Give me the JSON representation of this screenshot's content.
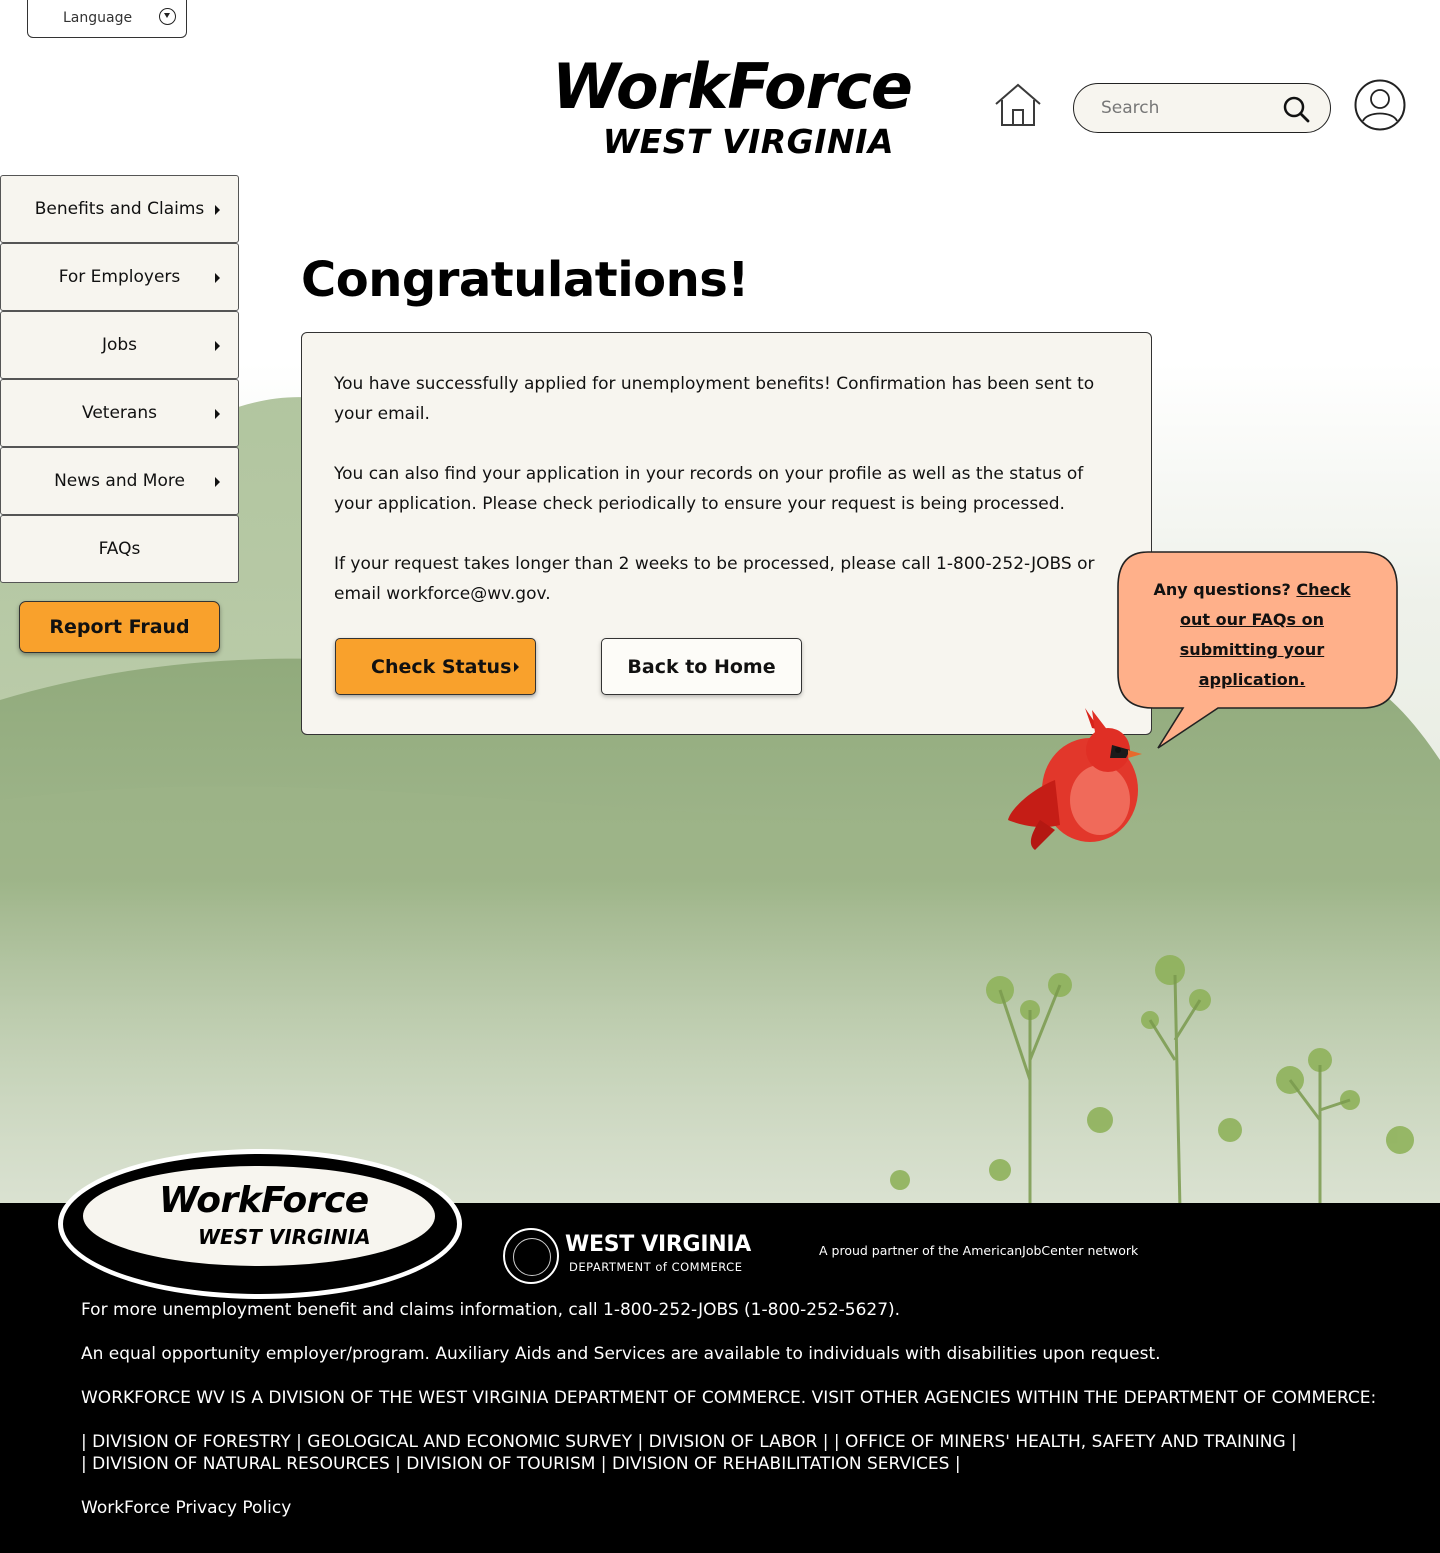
{
  "header": {
    "language_label": "Language",
    "logo_line1": "WorkForce",
    "logo_line2": "WEST VIRGINIA",
    "search_placeholder": "Search"
  },
  "sidebar": {
    "items": [
      {
        "label": "Benefits and Claims",
        "has_arrow": true
      },
      {
        "label": "For Employers",
        "has_arrow": true
      },
      {
        "label": "Jobs",
        "has_arrow": true
      },
      {
        "label": "Veterans",
        "has_arrow": true
      },
      {
        "label": "News and More",
        "has_arrow": true
      },
      {
        "label": "FAQs",
        "has_arrow": false
      }
    ],
    "report_fraud_label": "Report Fraud"
  },
  "main": {
    "title": "Congratulations!",
    "paragraphs": [
      "You have successfully applied for unemployment benefits! Confirmation has been sent to your email.",
      "You can also find your application in your records on your profile as well as the status of your application. Please check periodically to ensure your request is being processed.",
      "If your request takes longer than 2 weeks to be processed, please call 1-800-252-JOBS or email workforce@wv.gov."
    ],
    "check_status_label": "Check Status",
    "back_home_label": "Back to Home"
  },
  "bubble": {
    "prefix": "Any questions?",
    "link_text": "Check out our FAQs on submitting your application."
  },
  "footer": {
    "logo_line1": "WorkForce",
    "logo_line2": "WEST VIRGINIA",
    "wv_title": "WEST VIRGINIA",
    "wv_subtitle": "DEPARTMENT of COMMERCE",
    "partner_text": "A proud partner of the AmericanJobCenter network",
    "line1": "For more unemployment benefit and claims information, call 1-800-252-JOBS (1-800-252-5627).",
    "line2": "An equal opportunity employer/program. Auxiliary Aids and Services are available to individuals with disabilities upon request.",
    "line3": "WORKFORCE WV IS A DIVISION OF THE WEST VIRGINIA DEPARTMENT OF COMMERCE. VISIT OTHER AGENCIES WITHIN THE DEPARTMENT OF COMMERCE:",
    "agencies_line1": "| DIVISION OF FORESTRY  | GEOLOGICAL AND ECONOMIC SURVEY  | DIVISION OF LABOR | | OFFICE OF MINERS' HEALTH, SAFETY AND TRAINING  |",
    "agencies_line2": "| DIVISION OF NATURAL RESOURCES | DIVISION OF TOURISM  | DIVISION OF REHABILITATION SERVICES |",
    "privacy_label": "WorkForce Privacy Policy"
  },
  "colors": {
    "accent_orange": "#f9a12c",
    "card_bg": "#f7f5ef",
    "bubble_bg": "#ffb08a",
    "footer_bg": "#000000"
  }
}
